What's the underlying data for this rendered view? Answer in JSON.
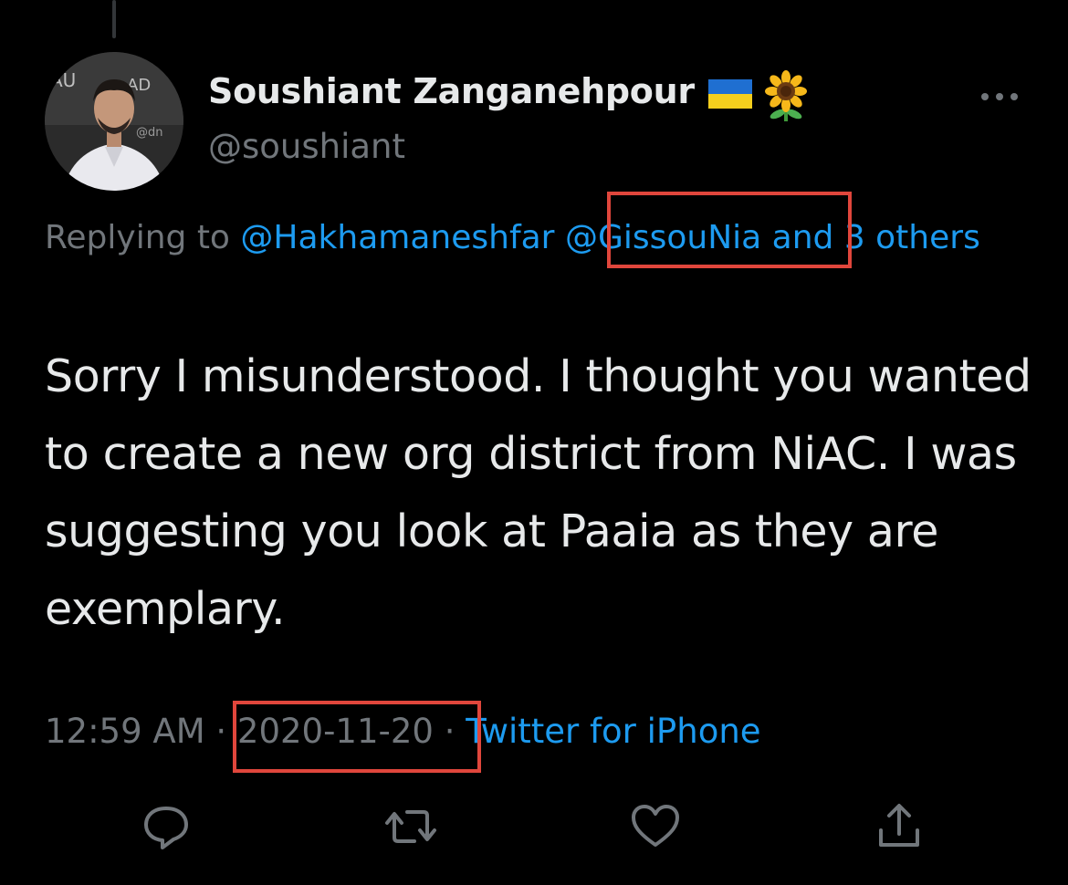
{
  "tweet": {
    "author": {
      "name": "Soushiant Zanganehpour",
      "handle": "@soushiant",
      "avatar_icon": "profile-photo"
    },
    "name_emojis": [
      "ukraine-flag-icon",
      "sunflower-icon"
    ],
    "reply_context": {
      "prefix": "Replying to",
      "mentions": [
        "@Hakhamaneshfar",
        "@GissouNia"
      ],
      "suffix": "and 3 others"
    },
    "text": "Sorry I misunderstood. I thought you wanted to create a new org district from NiAC. I was suggesting you look at Paaia as they are exemplary.",
    "time": "12:59 AM",
    "separator": "·",
    "date": "2020-11-20",
    "source": "Twitter for iPhone"
  },
  "actions": [
    "reply-icon",
    "retweet-icon",
    "like-icon",
    "share-icon"
  ],
  "colors": {
    "background": "#000000",
    "primary_text": "#e7e9ea",
    "secondary_text": "#71767b",
    "link": "#1d9bf0",
    "annotation_box": "#e0463c"
  }
}
